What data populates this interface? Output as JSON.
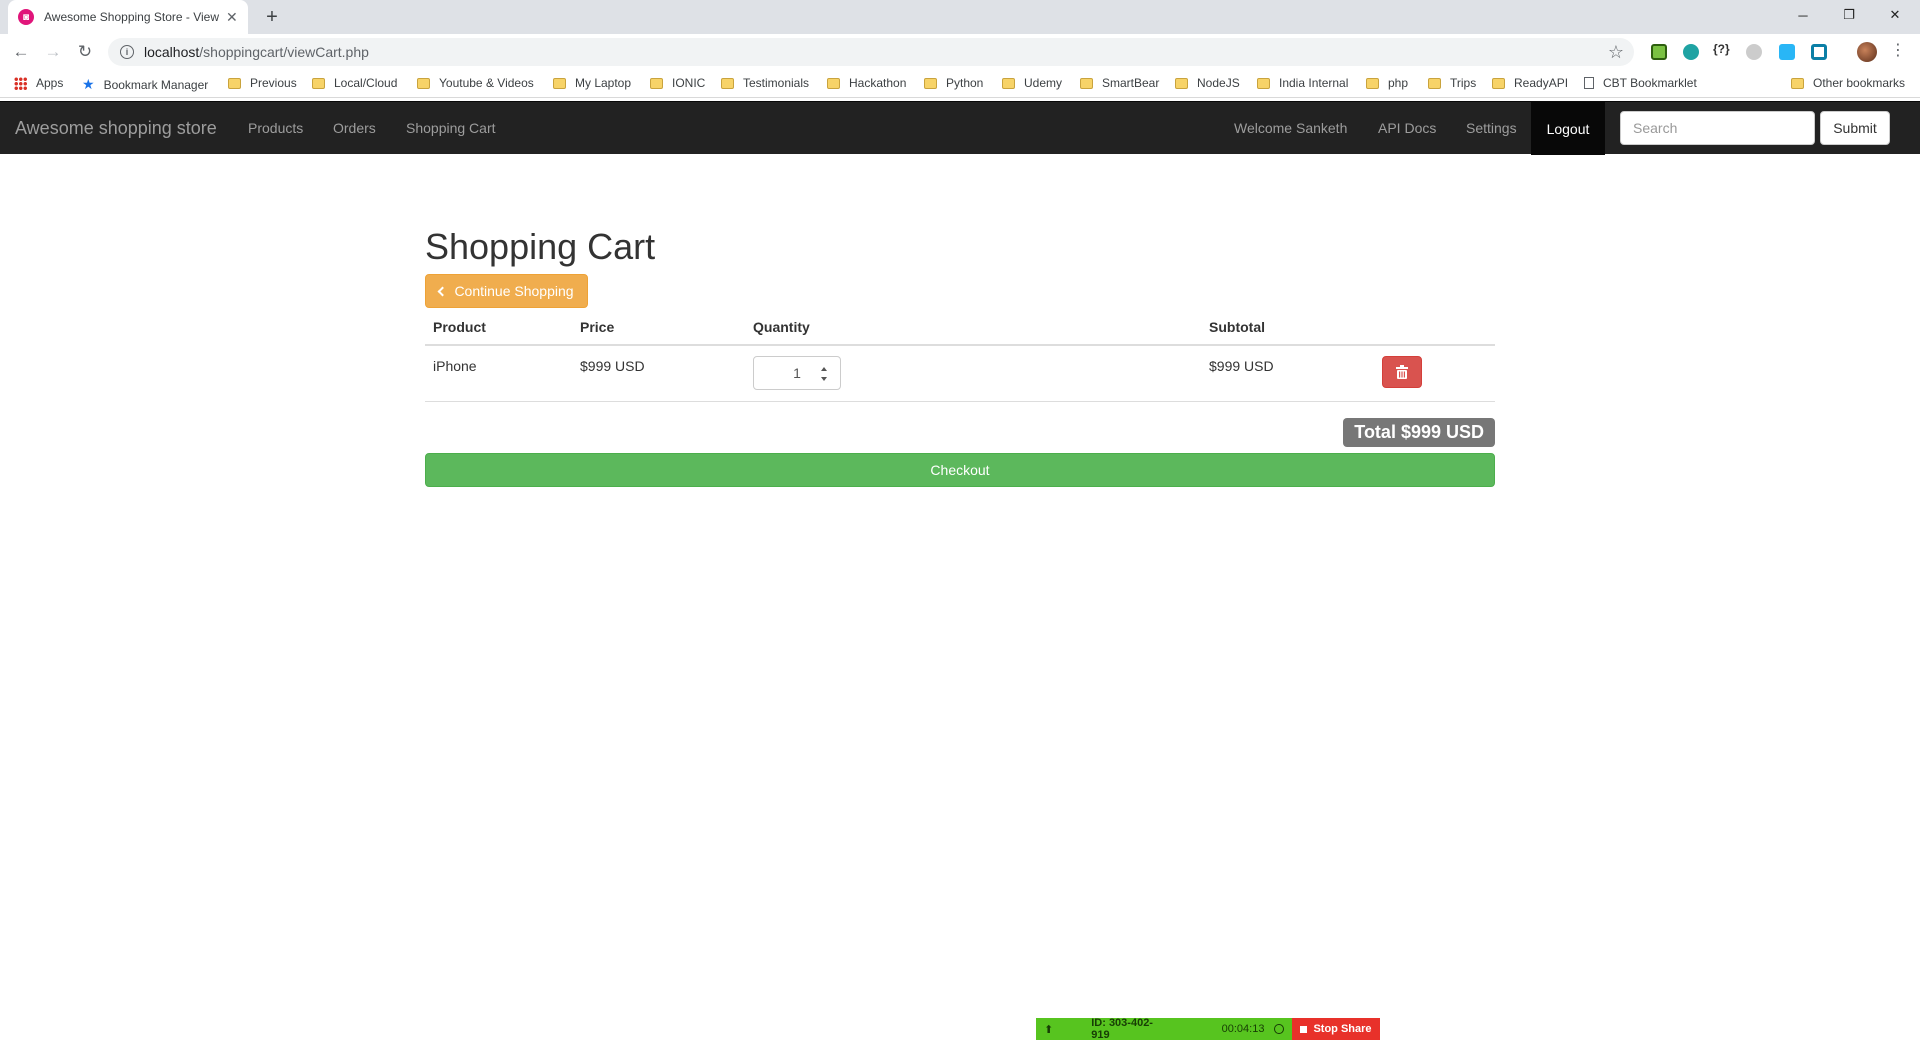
{
  "browser": {
    "tab_title": "Awesome Shopping Store - View",
    "tab_favicon": "magenta-store-icon",
    "url_host": "localhost",
    "url_path": "/shoppingcart/viewCart.php",
    "bookmarks": [
      "Apps",
      "Bookmark Manager",
      "Previous",
      "Local/Cloud",
      "Youtube & Videos",
      "My Laptop",
      "IONIC",
      "Testimonials",
      "Hackathon",
      "Python",
      "Udemy",
      "SmartBear",
      "NodeJS",
      "India Internal",
      "php",
      "Trips",
      "ReadyAPI",
      "CBT Bookmarklet"
    ],
    "other_bookmarks": "Other bookmarks"
  },
  "navbar": {
    "brand": "Awesome shopping store",
    "left_links": [
      "Products",
      "Orders",
      "Shopping Cart"
    ],
    "welcome": "Welcome Sanketh",
    "api_docs": "API Docs",
    "settings": "Settings",
    "logout": "Logout",
    "search_placeholder": "Search",
    "submit": "Submit"
  },
  "cart": {
    "title": "Shopping Cart",
    "continue_label": "Continue Shopping",
    "columns": [
      "Product",
      "Price",
      "Quantity",
      "Subtotal"
    ],
    "rows": [
      {
        "product": "iPhone",
        "price": "$999 USD",
        "quantity": "1",
        "subtotal": "$999 USD"
      }
    ],
    "total": "Total $999 USD",
    "checkout_label": "Checkout"
  },
  "share_bar": {
    "id": "ID: 303-402-919",
    "time": "00:04:13",
    "stop_label": "Stop Share"
  },
  "colors": {
    "navbar_bg": "#222222",
    "warning": "#f0ad4e",
    "danger": "#d9534f",
    "success": "#5cb85c",
    "total_badge": "#777777"
  }
}
